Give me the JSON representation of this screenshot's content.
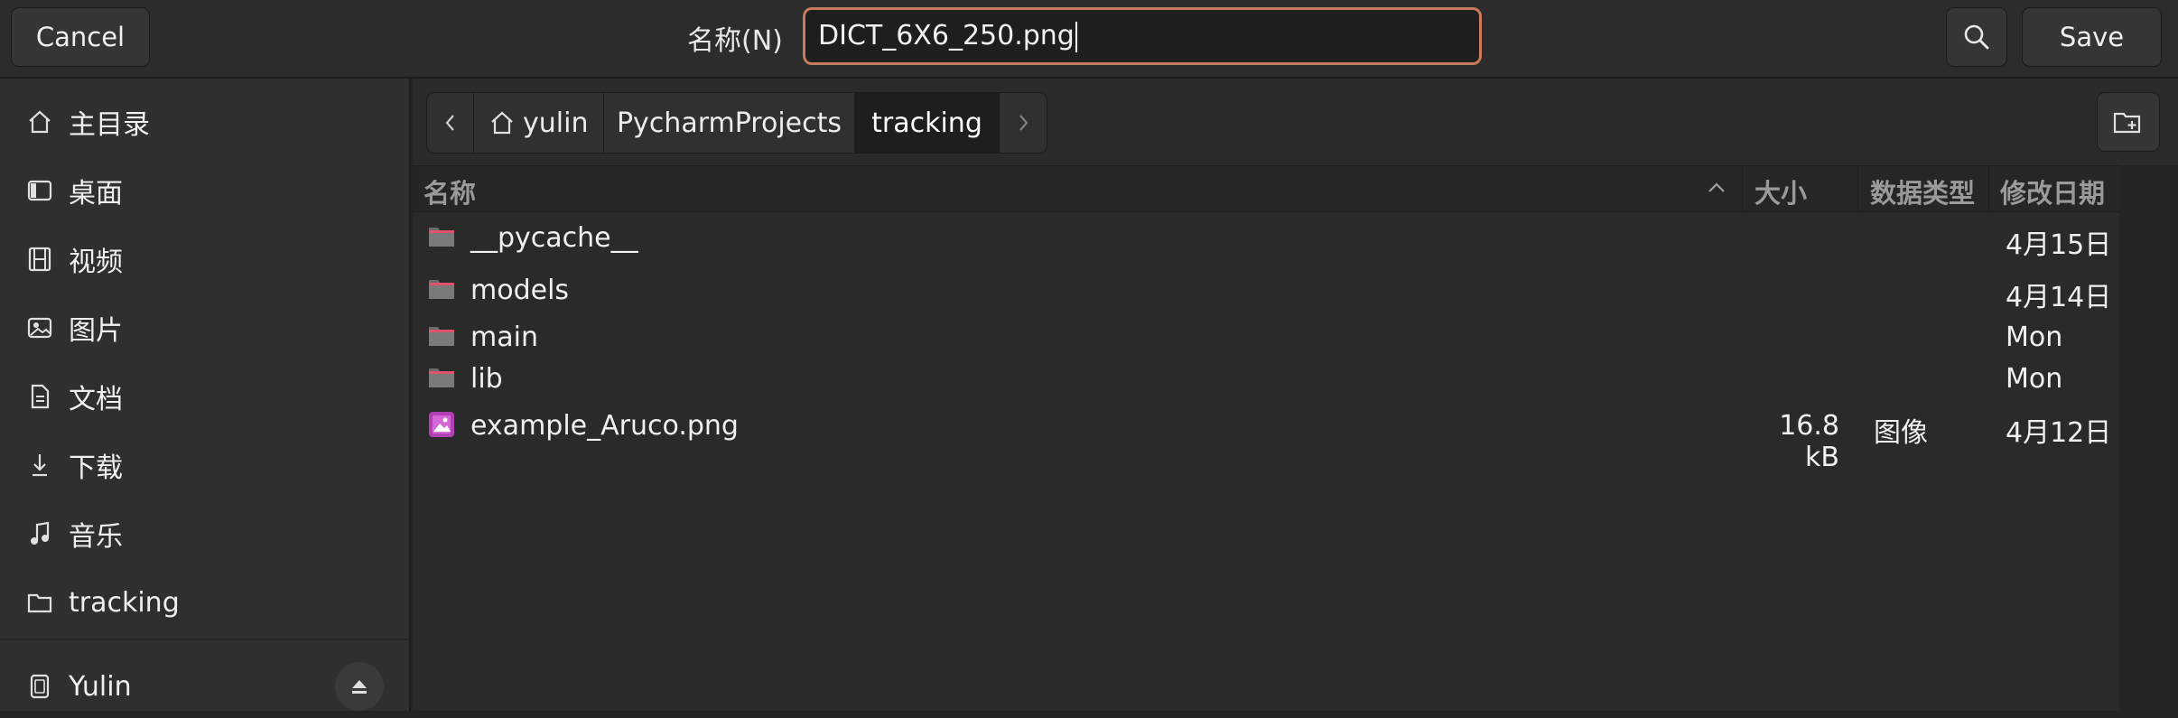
{
  "header": {
    "cancel_label": "Cancel",
    "name_label": "名称(N)",
    "filename_value": "DICT_6X6_250.png",
    "save_label": "Save",
    "accent_color": "#c87c5a"
  },
  "sidebar": {
    "items": [
      {
        "label": "主目录",
        "icon": "home-icon"
      },
      {
        "label": "桌面",
        "icon": "desktop-icon"
      },
      {
        "label": "视频",
        "icon": "film-icon"
      },
      {
        "label": "图片",
        "icon": "picture-icon"
      },
      {
        "label": "文档",
        "icon": "document-icon"
      },
      {
        "label": "下载",
        "icon": "download-icon"
      },
      {
        "label": "音乐",
        "icon": "music-icon"
      },
      {
        "label": "tracking",
        "icon": "folder-icon"
      }
    ],
    "device": {
      "label": "Yulin",
      "icon": "drive-icon"
    }
  },
  "pathbar": {
    "crumbs": [
      "yulin",
      "PycharmProjects",
      "tracking"
    ],
    "active_index": 2
  },
  "columns": {
    "name": "名称",
    "size": "大小",
    "type": "数据类型",
    "modified": "修改日期"
  },
  "files": [
    {
      "name": "__pycache__",
      "size": "",
      "type": "",
      "modified": "4月15日",
      "kind": "folder"
    },
    {
      "name": "models",
      "size": "",
      "type": "",
      "modified": "4月14日",
      "kind": "folder"
    },
    {
      "name": "main",
      "size": "",
      "type": "",
      "modified": "Mon",
      "kind": "folder"
    },
    {
      "name": "lib",
      "size": "",
      "type": "",
      "modified": "Mon",
      "kind": "folder"
    },
    {
      "name": "example_Aruco.png",
      "size": "16.8 kB",
      "type": "图像",
      "modified": "4月12日",
      "kind": "image"
    }
  ]
}
